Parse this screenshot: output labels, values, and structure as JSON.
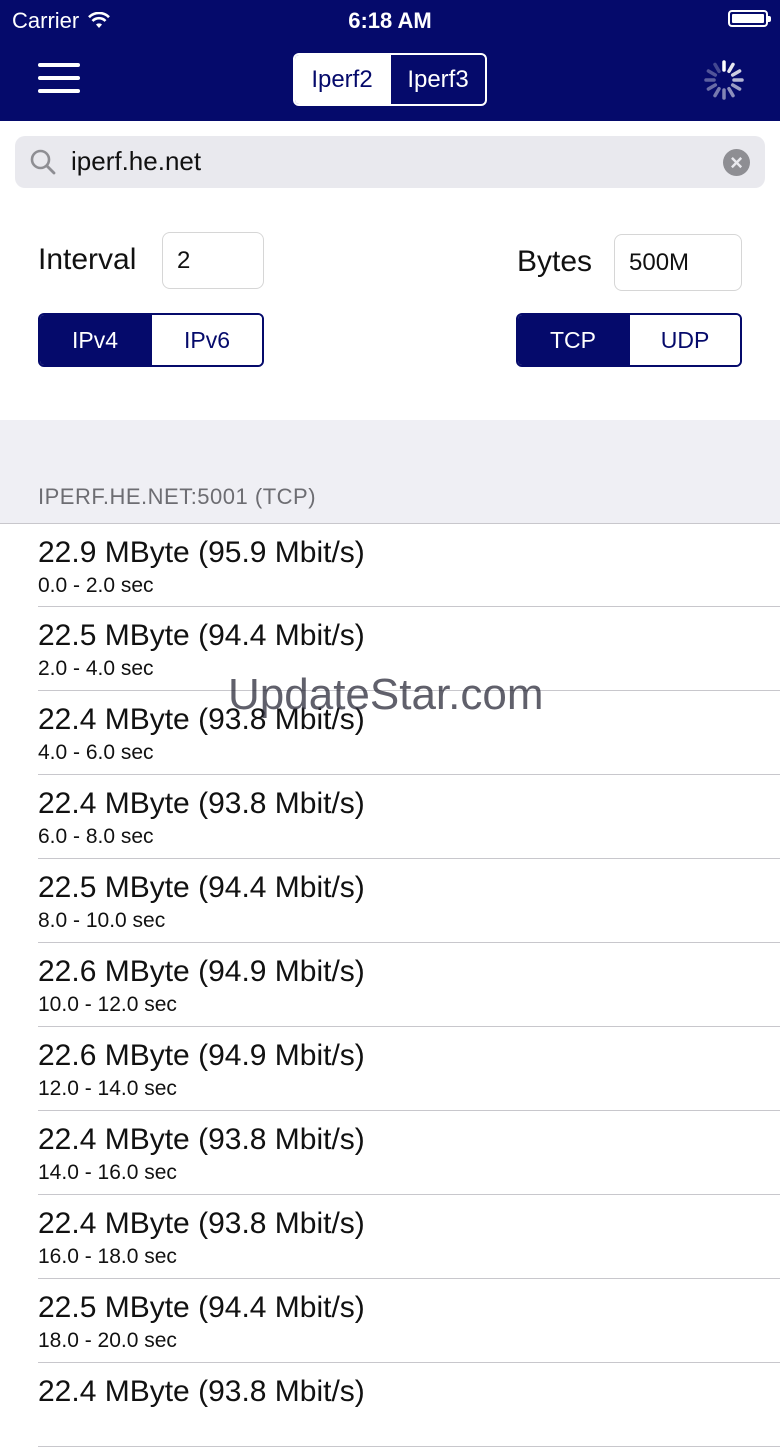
{
  "status_bar": {
    "carrier": "Carrier",
    "time": "6:18 AM"
  },
  "nav": {
    "segments": [
      {
        "label": "Iperf2",
        "selected": true
      },
      {
        "label": "Iperf3",
        "selected": false
      }
    ]
  },
  "search": {
    "value": "iperf.he.net"
  },
  "settings": {
    "interval_label": "Interval",
    "interval_value": "2",
    "bytes_label": "Bytes",
    "bytes_value": "500M",
    "ip_segments": [
      {
        "label": "IPv4",
        "selected": true
      },
      {
        "label": "IPv6",
        "selected": false
      }
    ],
    "protocol_segments": [
      {
        "label": "TCP",
        "selected": true
      },
      {
        "label": "UDP",
        "selected": false
      }
    ]
  },
  "results": {
    "section_header": "IPERF.HE.NET:5001 (TCP)",
    "rows": [
      {
        "title": "22.9 MByte (95.9 Mbit/s)",
        "subtitle": "0.0 - 2.0 sec"
      },
      {
        "title": "22.5 MByte (94.4 Mbit/s)",
        "subtitle": "2.0 - 4.0 sec"
      },
      {
        "title": "22.4 MByte (93.8 Mbit/s)",
        "subtitle": "4.0 - 6.0 sec"
      },
      {
        "title": "22.4 MByte (93.8 Mbit/s)",
        "subtitle": "6.0 - 8.0 sec"
      },
      {
        "title": "22.5 MByte (94.4 Mbit/s)",
        "subtitle": "8.0 - 10.0 sec"
      },
      {
        "title": "22.6 MByte (94.9 Mbit/s)",
        "subtitle": "10.0 - 12.0 sec"
      },
      {
        "title": "22.6 MByte (94.9 Mbit/s)",
        "subtitle": "12.0 - 14.0 sec"
      },
      {
        "title": "22.4 MByte (93.8 Mbit/s)",
        "subtitle": "14.0 - 16.0 sec"
      },
      {
        "title": "22.4 MByte (93.8 Mbit/s)",
        "subtitle": "16.0 - 18.0 sec"
      },
      {
        "title": "22.5 MByte (94.4 Mbit/s)",
        "subtitle": "18.0 - 20.0 sec"
      },
      {
        "title": "22.4 MByte (93.8 Mbit/s)",
        "subtitle": ""
      }
    ]
  },
  "watermark": "UpdateStar.com",
  "colors": {
    "nav_bg": "#050a6b",
    "accent": "#050a6b",
    "section_bg": "#efeff4"
  }
}
